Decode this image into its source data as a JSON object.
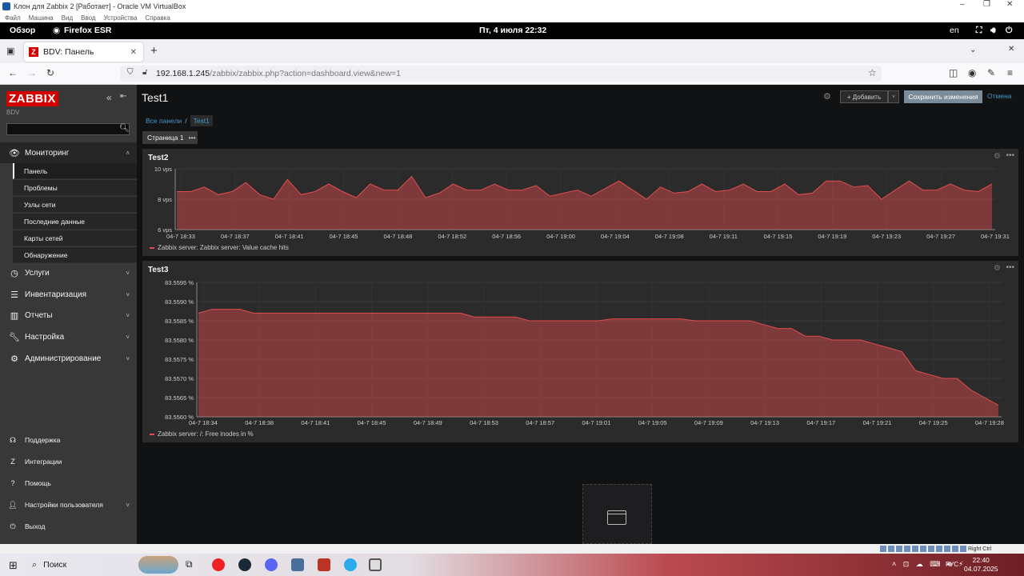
{
  "vbox": {
    "title": "Клон для Zabbix 2 [Работает] - Oracle VM VirtualBox",
    "menu": [
      "Файл",
      "Машина",
      "Вид",
      "Ввод",
      "Устройства",
      "Справка"
    ],
    "status_label": "Right Ctrl"
  },
  "gnome": {
    "activities": "Обзор",
    "app": "Firefox ESR",
    "clock": "Пт, 4 июля  22:32",
    "lang": "en"
  },
  "browser": {
    "tab_title": "BDV: Панель",
    "url_host": "192.168.1.245",
    "url_path": "/zabbix/zabbix.php?action=dashboard.view&new=1"
  },
  "sidebar": {
    "logo": "ZABBIX",
    "server_name": "BDV",
    "search_value": "",
    "sections": [
      {
        "label": "Мониторинг",
        "icon": "eye-icon",
        "expanded": true
      },
      {
        "label": "Услуги",
        "icon": "clock-icon"
      },
      {
        "label": "Инвентаризация",
        "icon": "list-icon"
      },
      {
        "label": "Отчеты",
        "icon": "bar-chart-icon"
      },
      {
        "label": "Настройка",
        "icon": "wrench-icon"
      },
      {
        "label": "Администрирование",
        "icon": "gear-icon"
      }
    ],
    "monitoring_items": [
      "Панель",
      "Проблемы",
      "Узлы сети",
      "Последние данные",
      "Карты сетей",
      "Обнаружение"
    ],
    "footer": [
      "Поддержка",
      "Интеграции",
      "Помощь",
      "Настройки пользователя",
      "Выход"
    ]
  },
  "dashboard": {
    "title": "Test1",
    "add_label": "Добавить",
    "save_label": "Сохранить изменения",
    "cancel_label": "Отмена",
    "breadcrumb_all": "Все панели",
    "breadcrumb_current": "Test1",
    "page_tab": "Страница 1"
  },
  "chart_data": [
    {
      "type": "area",
      "title": "Test2",
      "y_ticks": [
        "10 vps",
        "8 vps",
        "6 vps"
      ],
      "ylim": [
        6,
        10
      ],
      "x_ticks": [
        "04-7 18:33",
        "04-7 18:37",
        "04-7 18:41",
        "04-7 18:45",
        "04-7 18:48",
        "04-7 18:52",
        "04-7 18:56",
        "04-7 19:00",
        "04-7 19:04",
        "04-7 19:08",
        "04-7 19:11",
        "04-7 19:15",
        "04-7 19:19",
        "04-7 19:23",
        "04-7 19:27",
        "04-7 19:31"
      ],
      "series": [
        {
          "name": "Zabbix server: Zabbix server: Value cache hits",
          "color": "#e44d4d",
          "values": [
            8.5,
            8.5,
            8.8,
            8.3,
            8.5,
            9.1,
            8.3,
            8.0,
            9.3,
            8.3,
            8.5,
            9.0,
            8.5,
            8.1,
            9.0,
            8.6,
            8.6,
            9.5,
            8.1,
            8.4,
            9.0,
            8.6,
            8.6,
            9.0,
            8.6,
            8.6,
            8.9,
            8.2,
            8.4,
            8.6,
            8.2,
            8.7,
            9.2,
            8.6,
            8.0,
            8.8,
            8.4,
            8.5,
            9.0,
            8.5,
            8.6,
            9.0,
            8.5,
            8.5,
            9.0,
            8.3,
            8.4,
            9.2,
            9.2,
            8.8,
            8.9,
            8.0,
            8.6,
            9.2,
            8.6,
            8.6,
            9.0,
            8.6,
            8.5,
            9.0
          ]
        }
      ]
    },
    {
      "type": "area",
      "title": "Test3",
      "y_ticks": [
        "83.5595 %",
        "83.5590 %",
        "83.5585 %",
        "83.5580 %",
        "83.5575 %",
        "83.5570 %",
        "83.5565 %",
        "83.5560 %"
      ],
      "ylim": [
        83.556,
        83.5595
      ],
      "x_ticks": [
        "04-7 18:34",
        "04-7 18:38",
        "04-7 18:41",
        "04-7 18:45",
        "04-7 18:49",
        "04-7 18:53",
        "04-7 18:57",
        "04-7 19:01",
        "04-7 19:05",
        "04-7 19:09",
        "04-7 19:13",
        "04-7 19:17",
        "04-7 19:21",
        "04-7 19:25",
        "04-7 19:28"
      ],
      "series": [
        {
          "name": "Zabbix server: /: Free inodes in %",
          "color": "#e44d4d",
          "values": [
            83.5587,
            83.5588,
            83.5588,
            83.5588,
            83.5587,
            83.5587,
            83.5587,
            83.5587,
            83.5587,
            83.5587,
            83.5587,
            83.5587,
            83.5587,
            83.5587,
            83.5587,
            83.5587,
            83.5587,
            83.5587,
            83.5587,
            83.5587,
            83.5586,
            83.5586,
            83.5586,
            83.5586,
            83.5585,
            83.5585,
            83.5585,
            83.5585,
            83.5585,
            83.5585,
            83.55855,
            83.55855,
            83.55855,
            83.55855,
            83.55855,
            83.55855,
            83.5585,
            83.5585,
            83.5585,
            83.5585,
            83.5585,
            83.5584,
            83.5583,
            83.5583,
            83.5581,
            83.5581,
            83.558,
            83.558,
            83.558,
            83.5579,
            83.5578,
            83.5577,
            83.5572,
            83.5571,
            83.557,
            83.557,
            83.5567,
            83.5565,
            83.5563
          ]
        }
      ]
    }
  ],
  "os": {
    "search_label": "Поиск",
    "lang": "РУС",
    "time": "22:40",
    "date": "04.07.2025"
  }
}
